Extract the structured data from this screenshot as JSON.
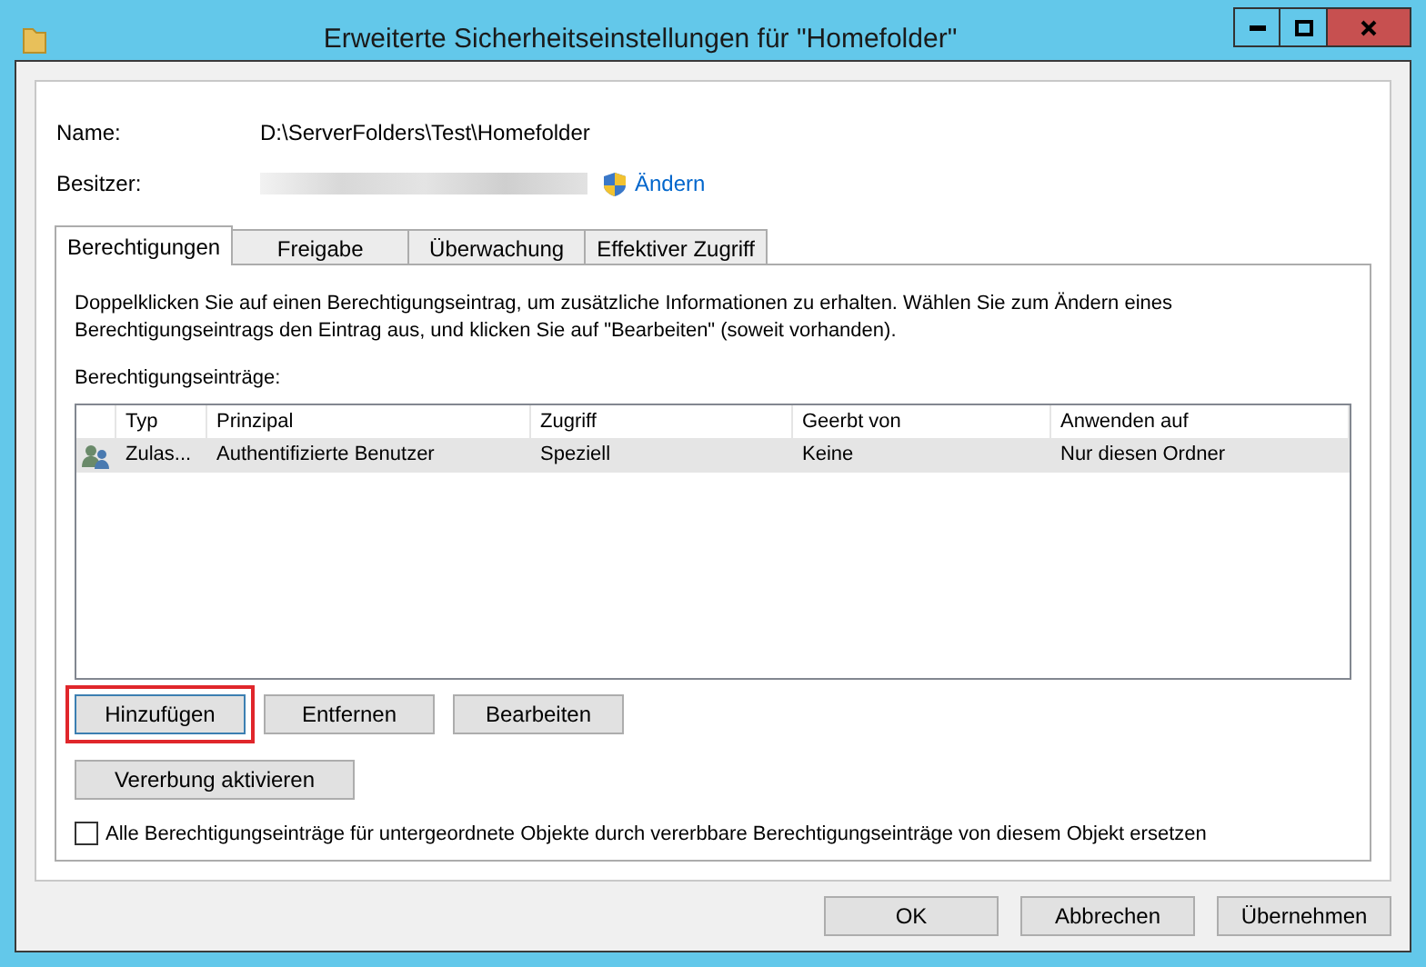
{
  "window": {
    "title": "Erweiterte Sicherheitseinstellungen für \"Homefolder\""
  },
  "name_field": {
    "label": "Name:",
    "value": "D:\\ServerFolders\\Test\\Homefolder"
  },
  "owner_field": {
    "label": "Besitzer:",
    "change_link": {
      "label": "Ändern"
    }
  },
  "tabs": [
    {
      "label": "Berechtigungen",
      "selected": true
    },
    {
      "label": "Freigabe",
      "selected": false
    },
    {
      "label": "Überwachung",
      "selected": false
    },
    {
      "label": "Effektiver Zugriff",
      "selected": false
    }
  ],
  "description": "Doppelklicken Sie auf einen Berechtigungseintrag, um zusätzliche Informationen zu erhalten. Wählen Sie zum Ändern eines Berechtigungseintrags den Eintrag aus, und klicken Sie auf \"Bearbeiten\" (soweit vorhanden).",
  "entries_label": "Berechtigungseinträge:",
  "table": {
    "columns": [
      "Typ",
      "Prinzipal",
      "Zugriff",
      "Geerbt von",
      "Anwenden auf"
    ],
    "rows": [
      {
        "cells": [
          "Zulas...",
          "Authentifizierte Benutzer",
          "Speziell",
          "Keine",
          "Nur diesen Ordner"
        ],
        "selected": true
      }
    ]
  },
  "entry_buttons": [
    {
      "label": "Hinzufügen",
      "highlighted": true
    },
    {
      "label": "Entfernen",
      "highlighted": false
    },
    {
      "label": "Bearbeiten",
      "highlighted": false
    }
  ],
  "inheritance_button": {
    "label": "Vererbung aktivieren"
  },
  "replace_checkbox": {
    "label": "Alle Berechtigungseinträge für untergeordnete Objekte durch vererbbare Berechtigungseinträge von diesem Objekt ersetzen",
    "checked": false
  },
  "footer_buttons": [
    {
      "label": "OK"
    },
    {
      "label": "Abbrechen"
    },
    {
      "label": "Übernehmen"
    }
  ]
}
